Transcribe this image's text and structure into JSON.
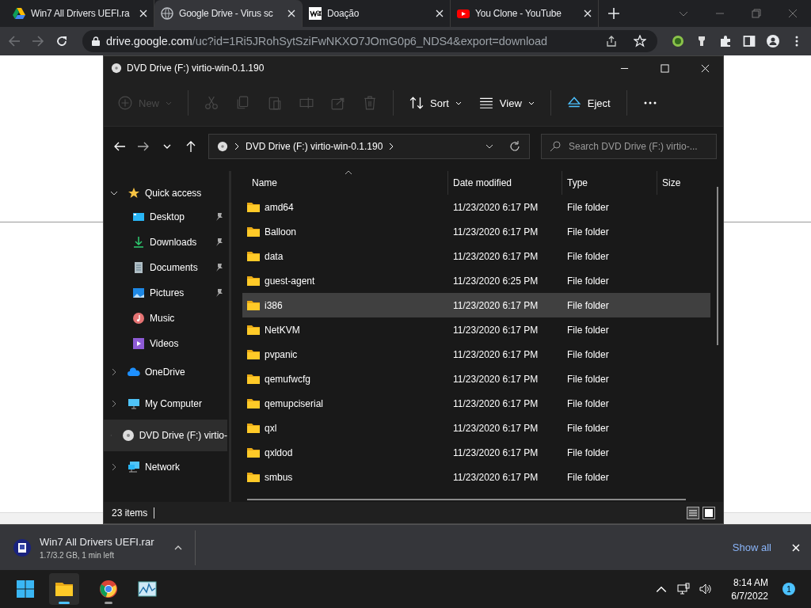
{
  "browser": {
    "tabs": [
      {
        "title": "Win7 All Drivers UEFI.ra",
        "kind": "drive",
        "selected": false
      },
      {
        "title": "Google Drive - Virus sc",
        "kind": "globe",
        "selected": true
      },
      {
        "title": "Doação",
        "kind": "wix",
        "selected": false
      },
      {
        "title": "You Clone - YouTube",
        "kind": "youtube",
        "selected": false
      }
    ],
    "address": {
      "host": "drive.google.com",
      "path": "/uc?id=1Ri5JRohSytSziFwNKXO7JOmG0p6_NDS4&export=download"
    }
  },
  "explorer": {
    "title": "DVD Drive (F:) virtio-win-0.1.190",
    "commands": [
      {
        "kind": "new",
        "label": "New",
        "disabled": true
      },
      {
        "kind": "cut",
        "disabled": true
      },
      {
        "kind": "copy",
        "disabled": true
      },
      {
        "kind": "paste",
        "disabled": true
      },
      {
        "kind": "rename",
        "disabled": true
      },
      {
        "kind": "share",
        "disabled": true
      },
      {
        "kind": "delete",
        "disabled": true
      },
      {
        "kind": "sort",
        "label": "Sort",
        "disabled": false
      },
      {
        "kind": "view",
        "label": "View",
        "disabled": false
      },
      {
        "kind": "eject",
        "label": "Eject",
        "disabled": false
      },
      {
        "kind": "more",
        "disabled": false
      }
    ],
    "path": "DVD Drive (F:) virtio-win-0.1.190",
    "search": {
      "placeholder": "Search DVD Drive (F:) virtio-..."
    },
    "nav": [
      {
        "label": "Quick access",
        "kind": "star",
        "expanded": true,
        "selected": false,
        "children": [
          {
            "label": "Desktop",
            "kind": "desktop",
            "pinned": true
          },
          {
            "label": "Downloads",
            "kind": "downloads",
            "pinned": true
          },
          {
            "label": "Documents",
            "kind": "documents",
            "pinned": true
          },
          {
            "label": "Pictures",
            "kind": "pictures",
            "pinned": true
          },
          {
            "label": "Music",
            "kind": "music",
            "pinned": false
          },
          {
            "label": "Videos",
            "kind": "videos",
            "pinned": false
          }
        ]
      },
      {
        "label": "OneDrive",
        "kind": "cloud",
        "expanded": false,
        "selected": false
      },
      {
        "label": "My Computer",
        "kind": "computer",
        "expanded": false,
        "selected": false
      },
      {
        "label": "DVD Drive (F:) virtio-",
        "kind": "disc",
        "expanded": false,
        "selected": true
      },
      {
        "label": "Network",
        "kind": "network",
        "expanded": false,
        "selected": false
      }
    ],
    "columns": [
      "Name",
      "Date modified",
      "Type",
      "Size"
    ],
    "rows": [
      {
        "name": "amd64",
        "date": "11/23/2020 6:17 PM",
        "type": "File folder",
        "selected": false
      },
      {
        "name": "Balloon",
        "date": "11/23/2020 6:17 PM",
        "type": "File folder",
        "selected": false
      },
      {
        "name": "data",
        "date": "11/23/2020 6:17 PM",
        "type": "File folder",
        "selected": false
      },
      {
        "name": "guest-agent",
        "date": "11/23/2020 6:25 PM",
        "type": "File folder",
        "selected": false
      },
      {
        "name": "i386",
        "date": "11/23/2020 6:17 PM",
        "type": "File folder",
        "selected": true
      },
      {
        "name": "NetKVM",
        "date": "11/23/2020 6:17 PM",
        "type": "File folder",
        "selected": false
      },
      {
        "name": "pvpanic",
        "date": "11/23/2020 6:17 PM",
        "type": "File folder",
        "selected": false
      },
      {
        "name": "qemufwcfg",
        "date": "11/23/2020 6:17 PM",
        "type": "File folder",
        "selected": false
      },
      {
        "name": "qemupciserial",
        "date": "11/23/2020 6:17 PM",
        "type": "File folder",
        "selected": false
      },
      {
        "name": "qxl",
        "date": "11/23/2020 6:17 PM",
        "type": "File folder",
        "selected": false
      },
      {
        "name": "qxldod",
        "date": "11/23/2020 6:17 PM",
        "type": "File folder",
        "selected": false
      },
      {
        "name": "smbus",
        "date": "11/23/2020 6:17 PM",
        "type": "File folder",
        "selected": false
      }
    ],
    "status": "23 items"
  },
  "download": {
    "file": "Win7 All Drivers UEFI.rar",
    "progress": "1.7/3.2 GB, 1 min left",
    "show_all": "Show all"
  },
  "taskbar": {
    "time": "8:14 AM",
    "date": "6/7/2022",
    "notifications": "1"
  }
}
